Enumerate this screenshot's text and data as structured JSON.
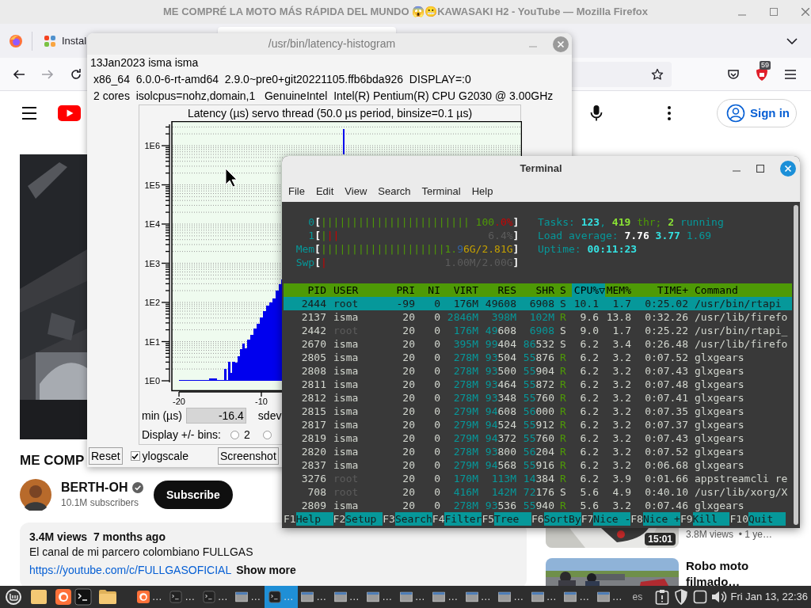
{
  "firefox": {
    "title": "ME COMPRÉ LA MOTO MÁS RÁPIDA DEL MUNDO 😱😬KAWASAKI H2 - YouTube — Mozilla Firefox",
    "tabs": [
      {
        "label": "Instal",
        "selected": false
      },
      {
        "selected": true
      }
    ],
    "extensions_badge": "59"
  },
  "youtube": {
    "sign_in": "Sign in",
    "title": "ME COMP",
    "channel": "BERTH-OH",
    "verified": true,
    "subscribers": "10.1M subscribers",
    "subscribe": "Subscribe",
    "description": {
      "meta": "3.4M views  7 months ago",
      "text": "El canal de mi parcero colombiano FULLGAS",
      "link": "https://youtube.com/c/FULLGASOFICIAL",
      "more": "Show more"
    },
    "related": [
      {
        "duration": "15:01",
        "meta": "3.8M views  • 1 ye…"
      },
      {
        "title": "Robo moto filmado…"
      }
    ]
  },
  "histogram": {
    "title": "/usr/bin/latency-histogram",
    "info": [
      "13Jan2023 isma isma",
      "x86_64  6.0.0-6-rt-amd64  2.9.0~pre0+git20221105.ffb6bda926  DISPLAY=:0",
      "2 cores  isolcpus=nohz,domain,1   GenuineIntel  Intel(R) Pentium(R) CPU G2030 @ 3.00GHz"
    ],
    "chart_title": "Latency (µs) servo thread (50.0 µs period, binsize=0.1 µs)",
    "y_ticks": [
      "1E6",
      "1E5",
      "1E4",
      "1E3",
      "1E2",
      "1E1",
      "1E0"
    ],
    "x_ticks": [
      "-20",
      "-10"
    ],
    "min_label": "min (µs)",
    "min_value": "-16.4",
    "sdev_label": "sdev",
    "bins_label": "Display +/- bins:",
    "bins": [
      {
        "label": "2",
        "selected": false
      },
      {
        "selected": false
      }
    ],
    "reset": "Reset",
    "ylogscale": {
      "label": "ylogscale",
      "checked": true
    },
    "screenshot": "Screenshot"
  },
  "terminal": {
    "title": "Terminal",
    "menu": [
      "File",
      "Edit",
      "View",
      "Search",
      "Terminal",
      "Help"
    ],
    "meters": [
      {
        "label": "0",
        "open": "[",
        "bars": [
          {
            "text": "||||||||||||||||||||||||",
            "kind": "normal"
          }
        ],
        "value": [
          {
            "text": "100",
            "kind": "normal"
          },
          {
            "text": ".0%",
            "kind": "alert"
          }
        ],
        "close": "]"
      },
      {
        "label": "1",
        "open": "[",
        "bars": [
          {
            "text": "|",
            "kind": "normal"
          },
          {
            "text": "||",
            "kind": "alert"
          }
        ],
        "value": [
          {
            "text": "6.4%",
            "kind": "dim"
          }
        ],
        "close": "]"
      },
      {
        "label": "Mem",
        "open": "[",
        "bars": [
          {
            "text": "||||||||||||||||||||",
            "kind": "normal"
          }
        ],
        "value": [
          {
            "text": "1.",
            "kind": "normal"
          },
          {
            "text": "9",
            "kind": "buffer"
          },
          {
            "text": "6G/2.81G",
            "kind": "cache"
          }
        ],
        "close": "]"
      },
      {
        "label": "Swp",
        "open": "[",
        "bars": [
          {
            "text": "|",
            "kind": "alert"
          }
        ],
        "value": [
          {
            "text": "1.00M/2.00G",
            "kind": "dim"
          }
        ],
        "close": "]"
      }
    ],
    "summary": [
      [
        {
          "text": "Tasks: ",
          "kind": "label"
        },
        {
          "text": "123",
          "kind": "value"
        },
        {
          "text": ", ",
          "kind": "label"
        },
        {
          "text": "419",
          "kind": "green"
        },
        {
          "text": " thr; ",
          "kind": "dimgreen"
        },
        {
          "text": "2",
          "kind": "green"
        },
        {
          "text": " running",
          "kind": "label"
        }
      ],
      [
        {
          "text": "Load average: ",
          "kind": "label"
        },
        {
          "text": "7.76",
          "kind": "white"
        },
        {
          "text": " 3.77",
          "kind": "value"
        },
        {
          "text": " 1.69",
          "kind": "label"
        }
      ],
      [
        {
          "text": "Uptime: ",
          "kind": "label"
        },
        {
          "text": "00:11:23",
          "kind": "value"
        }
      ]
    ],
    "columns": [
      {
        "label": "PID",
        "selected": false
      },
      {
        "label": "USER",
        "selected": false
      },
      {
        "label": "PRI",
        "selected": false
      },
      {
        "label": "NI",
        "selected": false
      },
      {
        "label": "VIRT",
        "selected": false
      },
      {
        "label": "RES",
        "selected": false
      },
      {
        "label": "SHR",
        "selected": false
      },
      {
        "label": "S",
        "selected": false
      },
      {
        "label": "CPU%▽",
        "selected": true
      },
      {
        "label": "MEM%",
        "selected": false
      },
      {
        "label": "TIME+",
        "selected": false
      },
      {
        "label": "Command",
        "selected": false
      }
    ],
    "rows": [
      {
        "pid": "2444",
        "user": "root",
        "pri": "-99",
        "ni": "0",
        "virt": "176M",
        "res": "49608",
        "shr": "6908",
        "state": "S",
        "cpu": "10.1",
        "mem": "1.7",
        "time": "0:25.02",
        "command": "/usr/bin/rtapi",
        "selected": true,
        "dim_user": false,
        "running": false
      },
      {
        "pid": "2137",
        "user": "isma",
        "pri": "20",
        "ni": "0",
        "virt": "2846M",
        "res": "398M",
        "shr": "102M",
        "state": "R",
        "cpu": "9.6",
        "mem": "13.8",
        "time": "0:32.26",
        "command": "/usr/lib/firefo",
        "selected": false,
        "dim_user": false,
        "running": true
      },
      {
        "pid": "2442",
        "user": "root",
        "pri": "20",
        "ni": "0",
        "virt": "176M",
        "res": "49608",
        "shr": "6908",
        "state": "S",
        "cpu": "9.0",
        "mem": "1.7",
        "time": "0:25.22",
        "command": "/usr/bin/rtapi_",
        "selected": false,
        "dim_user": true,
        "running": false
      },
      {
        "pid": "2670",
        "user": "isma",
        "pri": "20",
        "ni": "0",
        "virt": "395M",
        "res": "99404",
        "shr": "86532",
        "state": "S",
        "cpu": "6.2",
        "mem": "3.4",
        "time": "0:26.48",
        "command": "/usr/lib/firefo",
        "selected": false,
        "dim_user": false,
        "running": false
      },
      {
        "pid": "2805",
        "user": "isma",
        "pri": "20",
        "ni": "0",
        "virt": "278M",
        "res": "93504",
        "shr": "55876",
        "state": "R",
        "cpu": "6.2",
        "mem": "3.2",
        "time": "0:07.52",
        "command": "glxgears",
        "selected": false,
        "dim_user": false,
        "running": true
      },
      {
        "pid": "2808",
        "user": "isma",
        "pri": "20",
        "ni": "0",
        "virt": "278M",
        "res": "93500",
        "shr": "55904",
        "state": "R",
        "cpu": "6.2",
        "mem": "3.2",
        "time": "0:07.43",
        "command": "glxgears",
        "selected": false,
        "dim_user": false,
        "running": true
      },
      {
        "pid": "2811",
        "user": "isma",
        "pri": "20",
        "ni": "0",
        "virt": "278M",
        "res": "93464",
        "shr": "55872",
        "state": "R",
        "cpu": "6.2",
        "mem": "3.2",
        "time": "0:07.48",
        "command": "glxgears",
        "selected": false,
        "dim_user": false,
        "running": true
      },
      {
        "pid": "2812",
        "user": "isma",
        "pri": "20",
        "ni": "0",
        "virt": "278M",
        "res": "93348",
        "shr": "55760",
        "state": "R",
        "cpu": "6.2",
        "mem": "3.2",
        "time": "0:07.41",
        "command": "glxgears",
        "selected": false,
        "dim_user": false,
        "running": true
      },
      {
        "pid": "2815",
        "user": "isma",
        "pri": "20",
        "ni": "0",
        "virt": "279M",
        "res": "94608",
        "shr": "56000",
        "state": "R",
        "cpu": "6.2",
        "mem": "3.2",
        "time": "0:07.35",
        "command": "glxgears",
        "selected": false,
        "dim_user": false,
        "running": true
      },
      {
        "pid": "2817",
        "user": "isma",
        "pri": "20",
        "ni": "0",
        "virt": "279M",
        "res": "94524",
        "shr": "55912",
        "state": "R",
        "cpu": "6.2",
        "mem": "3.2",
        "time": "0:07.37",
        "command": "glxgears",
        "selected": false,
        "dim_user": false,
        "running": true
      },
      {
        "pid": "2819",
        "user": "isma",
        "pri": "20",
        "ni": "0",
        "virt": "279M",
        "res": "94372",
        "shr": "55760",
        "state": "R",
        "cpu": "6.2",
        "mem": "3.2",
        "time": "0:07.43",
        "command": "glxgears",
        "selected": false,
        "dim_user": false,
        "running": true
      },
      {
        "pid": "2820",
        "user": "isma",
        "pri": "20",
        "ni": "0",
        "virt": "278M",
        "res": "93800",
        "shr": "56204",
        "state": "R",
        "cpu": "6.2",
        "mem": "3.2",
        "time": "0:07.52",
        "command": "glxgears",
        "selected": false,
        "dim_user": false,
        "running": true
      },
      {
        "pid": "2837",
        "user": "isma",
        "pri": "20",
        "ni": "0",
        "virt": "279M",
        "res": "94568",
        "shr": "55916",
        "state": "R",
        "cpu": "6.2",
        "mem": "3.2",
        "time": "0:06.68",
        "command": "glxgears",
        "selected": false,
        "dim_user": false,
        "running": true
      },
      {
        "pid": "3276",
        "user": "root",
        "pri": "20",
        "ni": "0",
        "virt": "170M",
        "res": "113M",
        "shr": "14384",
        "state": "R",
        "cpu": "6.2",
        "mem": "3.9",
        "time": "0:01.66",
        "command": "appstreamcli re",
        "selected": false,
        "dim_user": true,
        "running": true
      },
      {
        "pid": "708",
        "user": "root",
        "pri": "20",
        "ni": "0",
        "virt": "416M",
        "res": "142M",
        "shr": "72176",
        "state": "S",
        "cpu": "5.6",
        "mem": "4.9",
        "time": "0:40.10",
        "command": "/usr/lib/xorg/X",
        "selected": false,
        "dim_user": true,
        "running": false
      },
      {
        "pid": "2809",
        "user": "isma",
        "pri": "20",
        "ni": "0",
        "virt": "278M",
        "res": "93536",
        "shr": "55940",
        "state": "R",
        "cpu": "5.6",
        "mem": "3.2",
        "time": "0:07.46",
        "command": "glxgears",
        "selected": false,
        "dim_user": false,
        "running": true
      }
    ],
    "fkeys": [
      {
        "key": "F1",
        "label": "Help"
      },
      {
        "key": "F2",
        "label": "Setup"
      },
      {
        "key": "F3",
        "label": "Search"
      },
      {
        "key": "F4",
        "label": "Filter"
      },
      {
        "key": "F5",
        "label": "Tree"
      },
      {
        "key": "F6",
        "label": "SortBy"
      },
      {
        "key": "F7",
        "label": "Nice -"
      },
      {
        "key": "F8",
        "label": "Nice +"
      },
      {
        "key": "F9",
        "label": "Kill"
      },
      {
        "key": "F10",
        "label": "Quit"
      }
    ]
  },
  "taskbar": {
    "launchers": [
      {
        "kind": "menu"
      },
      {
        "kind": "notes"
      },
      {
        "kind": "firefox"
      },
      {
        "kind": "terminal"
      },
      {
        "kind": "folder"
      }
    ],
    "windows": [
      {
        "kind": "firefox",
        "label": "…",
        "selected": false
      },
      {
        "kind": "terminal",
        "label": "…",
        "selected": false
      },
      {
        "kind": "terminal",
        "label": "…",
        "selected": false
      },
      {
        "kind": "window",
        "label": "…",
        "selected": false
      },
      {
        "kind": "terminal",
        "label": "…",
        "selected": true
      },
      {
        "kind": "window",
        "label": "…",
        "selected": false
      },
      {
        "kind": "window",
        "label": "…",
        "selected": false
      },
      {
        "kind": "window",
        "label": "…",
        "selected": false
      },
      {
        "kind": "window",
        "label": "…",
        "selected": false
      },
      {
        "kind": "window",
        "label": "…",
        "selected": false
      },
      {
        "kind": "window",
        "label": "…",
        "selected": false
      },
      {
        "kind": "window",
        "label": "…",
        "selected": false
      },
      {
        "kind": "window",
        "label": "…",
        "selected": false
      },
      {
        "kind": "window",
        "label": "…",
        "selected": false
      },
      {
        "kind": "window",
        "label": "…",
        "selected": false
      }
    ],
    "language": "es",
    "clock": "Fri Jan 13, 22:36"
  }
}
